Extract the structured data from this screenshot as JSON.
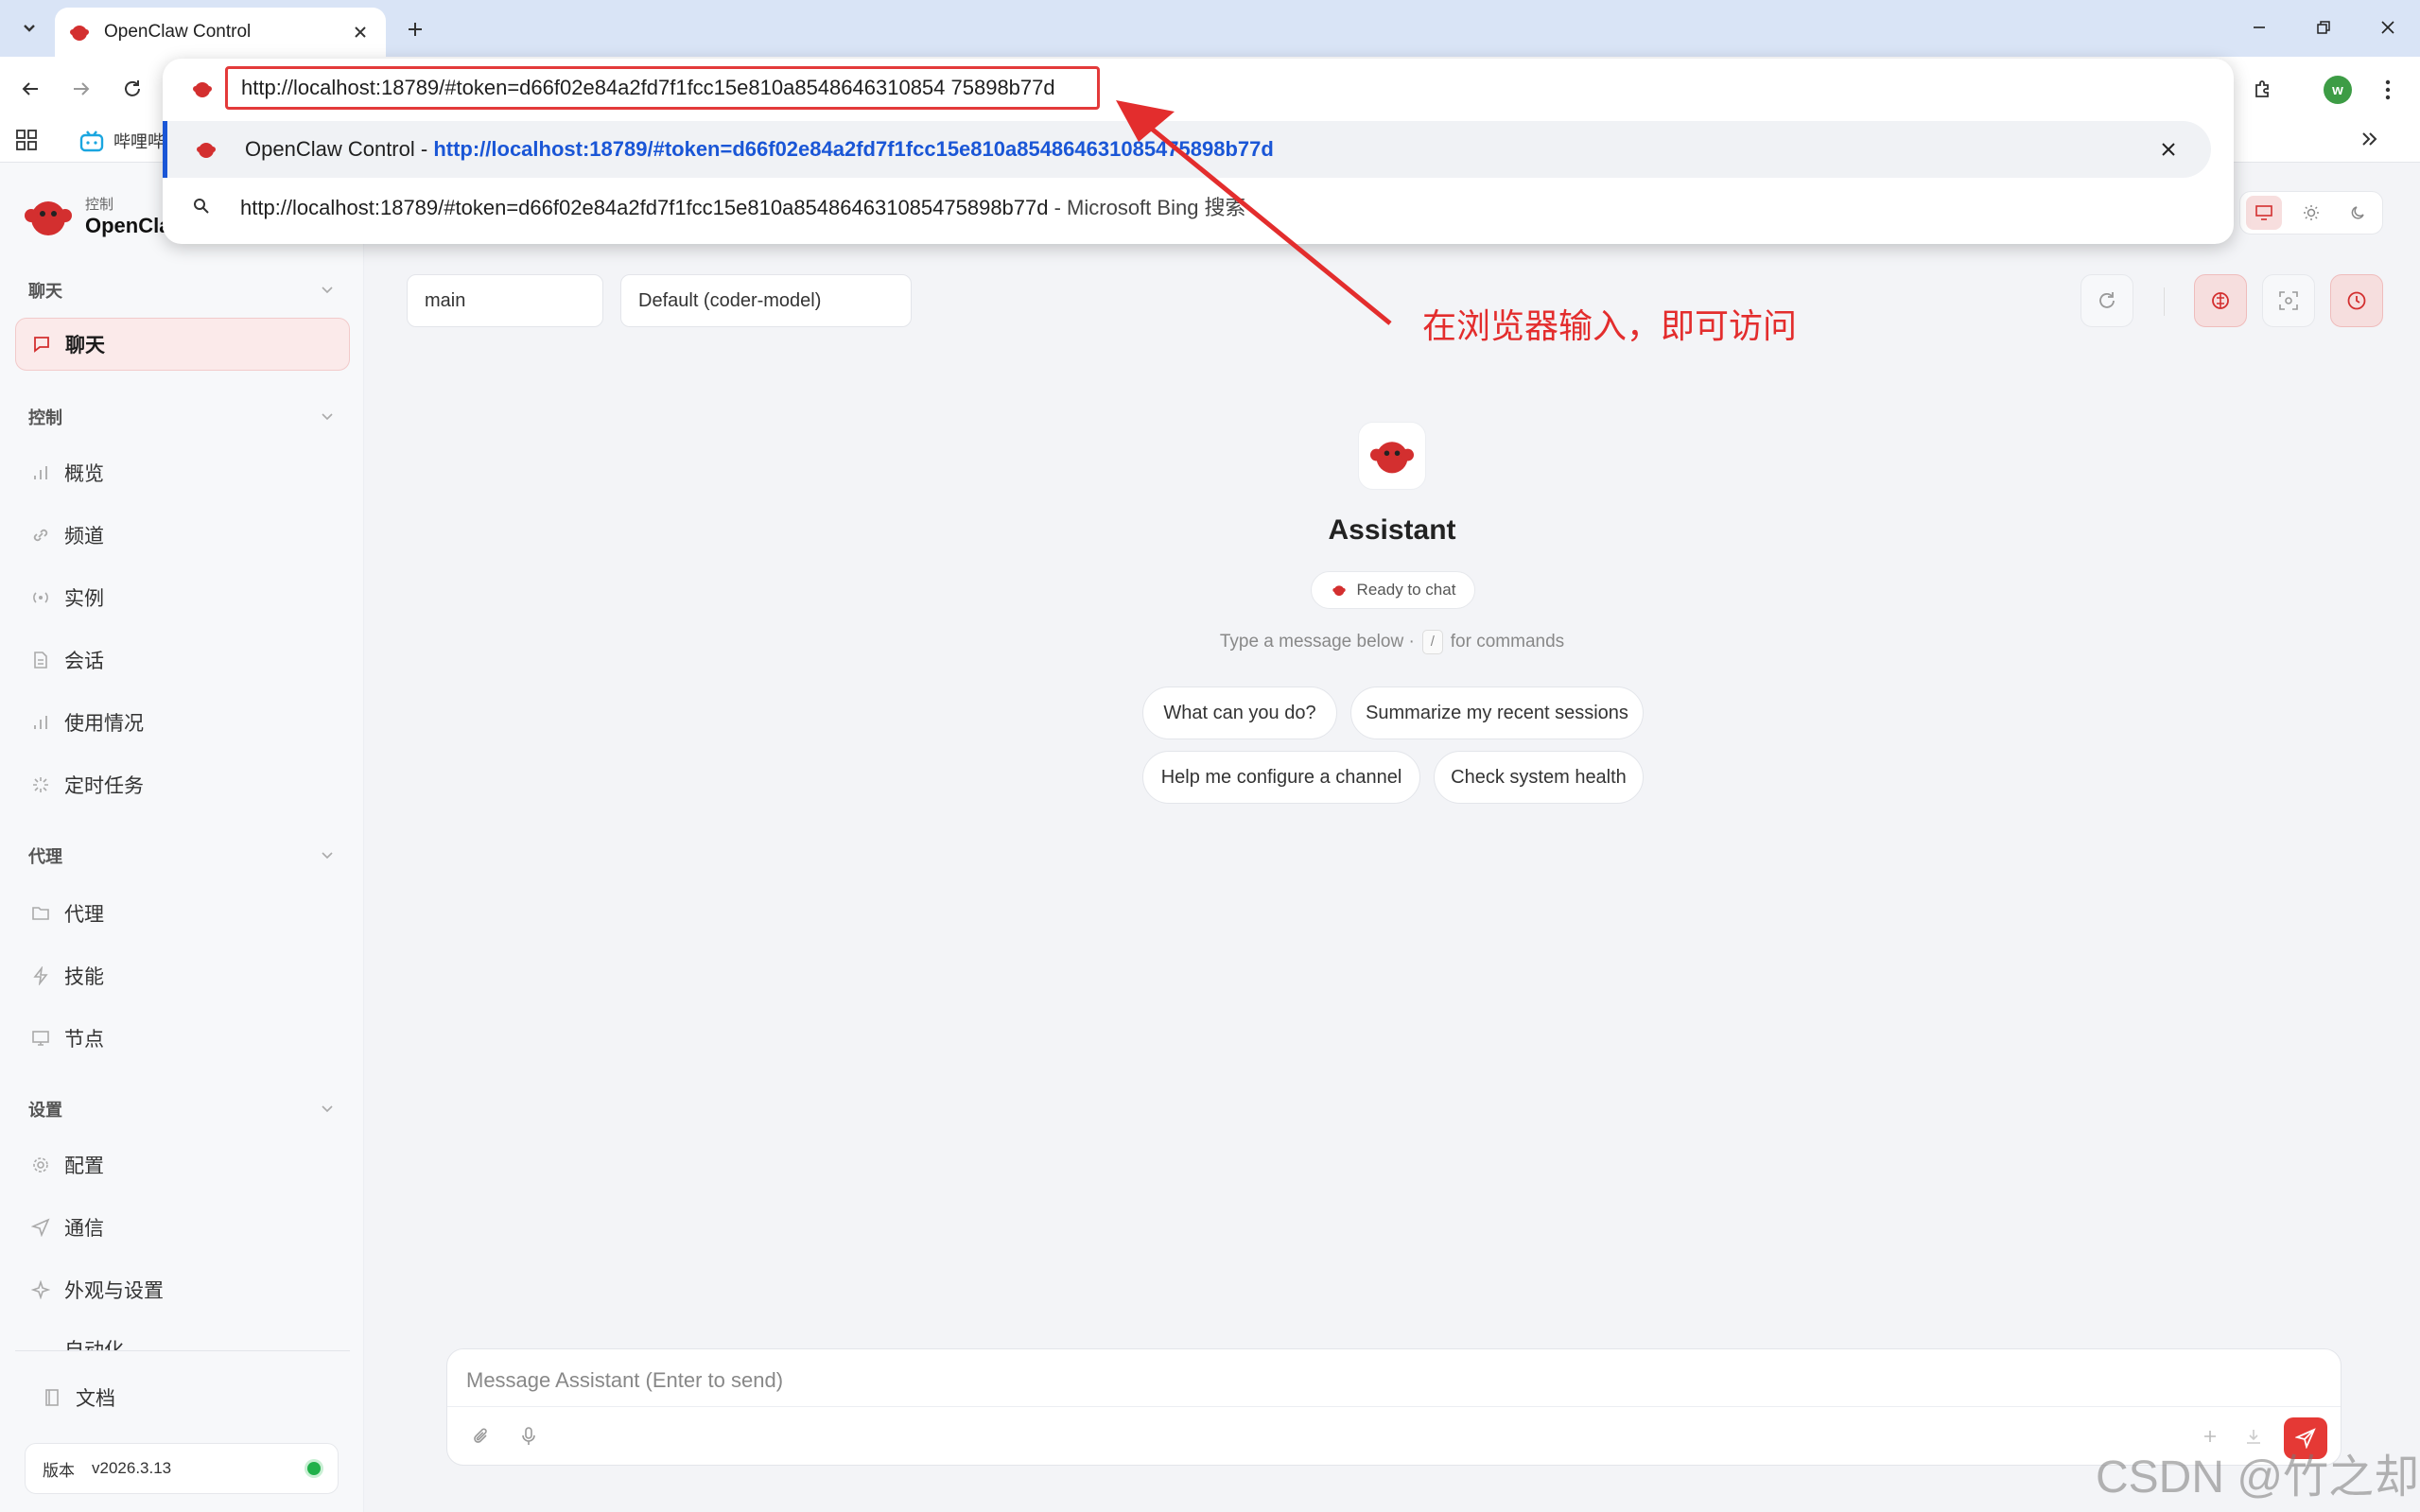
{
  "browser": {
    "tab_title": "OpenClaw Control",
    "bookmark_label": "哔哩哔",
    "address": {
      "url_host": "http://localhost",
      "url_rest": ":18789/#token=d66f02e84a2fd7f1fcc15e810a8548646310854 75898b77d"
    },
    "suggestions": [
      {
        "title": "OpenClaw Control - ",
        "url": "http://localhost:18789/#token=d66f02e84a2fd7f1fcc15e810a854864631085475898b77d"
      },
      {
        "query": "http://localhost:18789/#token=d66f02e84a2fd7f1fcc15e810a854864631085475898b77d",
        "engine": " - Microsoft Bing 搜索"
      }
    ],
    "avatar_letter": "w"
  },
  "sidebar": {
    "brand_small": "控制",
    "brand_name": "OpenClaw",
    "sections": {
      "chat": "聊天",
      "control": "控制",
      "agent": "代理",
      "settings": "设置"
    },
    "items": {
      "chat": "聊天",
      "overview": "概览",
      "channels": "频道",
      "instances": "实例",
      "sessions": "会话",
      "usage": "使用情况",
      "cron": "定时任务",
      "agents": "代理",
      "skills": "技能",
      "nodes": "节点",
      "config": "配置",
      "comms": "通信",
      "appearance": "外观与设置",
      "automation": "自动化",
      "docs": "文档"
    },
    "version_label": "版本",
    "version_value": "v2026.3.13"
  },
  "main": {
    "session": "main",
    "model": "Default (coder-model)",
    "assistant_name": "Assistant",
    "status": "Ready to chat",
    "hint_before": "Type a message below ·",
    "hint_key": "/",
    "hint_after": "for commands",
    "chips": [
      "What can you do?",
      "Summarize my recent sessions",
      "Help me configure a channel",
      "Check system health"
    ],
    "composer_placeholder": "Message Assistant (Enter to send)"
  },
  "annotation": "在浏览器输入，即可访问",
  "watermark": "CSDN @竹之却",
  "colors": {
    "accent": "#e53935",
    "link": "#1a56d6",
    "annotation": "#e32d2d"
  }
}
